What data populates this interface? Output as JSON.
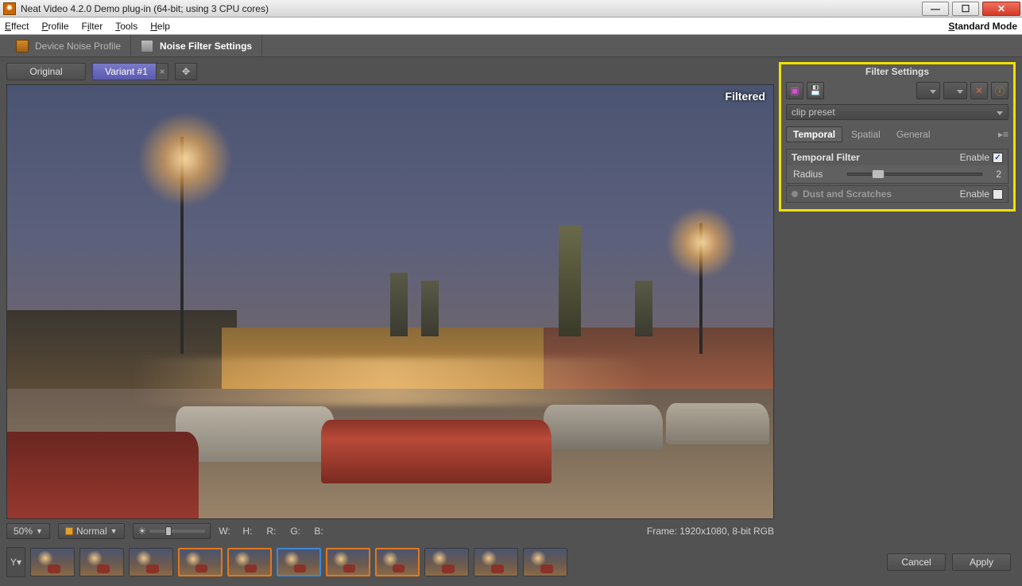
{
  "titlebar": {
    "title": "Neat Video 4.2.0 Demo plug-in (64-bit; using 3 CPU cores)"
  },
  "menu": {
    "effect": "Effect",
    "profile": "Profile",
    "filter": "Filter",
    "tools": "Tools",
    "help": "Help",
    "mode": "Standard Mode"
  },
  "tabs": {
    "profile": "Device Noise Profile",
    "filter": "Noise Filter Settings"
  },
  "ptoolbar": {
    "original": "Original",
    "variant": "Variant #1"
  },
  "preview": {
    "filtered_label": "Filtered"
  },
  "infobar": {
    "zoom": "50%",
    "mode": "Normal",
    "W": "W:",
    "H": "H:",
    "R": "R:",
    "G": "G:",
    "B": "B:",
    "frame": "Frame:  1920x1080, 8-bit RGB"
  },
  "thumb_y": "Y▾",
  "filter_panel": {
    "title": "Filter Settings",
    "preset": "clip preset",
    "tabs": {
      "temporal": "Temporal",
      "spatial": "Spatial",
      "general": "General"
    },
    "temporal_filter": {
      "title": "Temporal Filter",
      "enable_label": "Enable",
      "enabled": true,
      "radius_label": "Radius",
      "radius_value": "2"
    },
    "dust": {
      "title": "Dust and Scratches",
      "enable_label": "Enable",
      "enabled": false
    }
  },
  "buttons": {
    "cancel": "Cancel",
    "apply": "Apply"
  }
}
